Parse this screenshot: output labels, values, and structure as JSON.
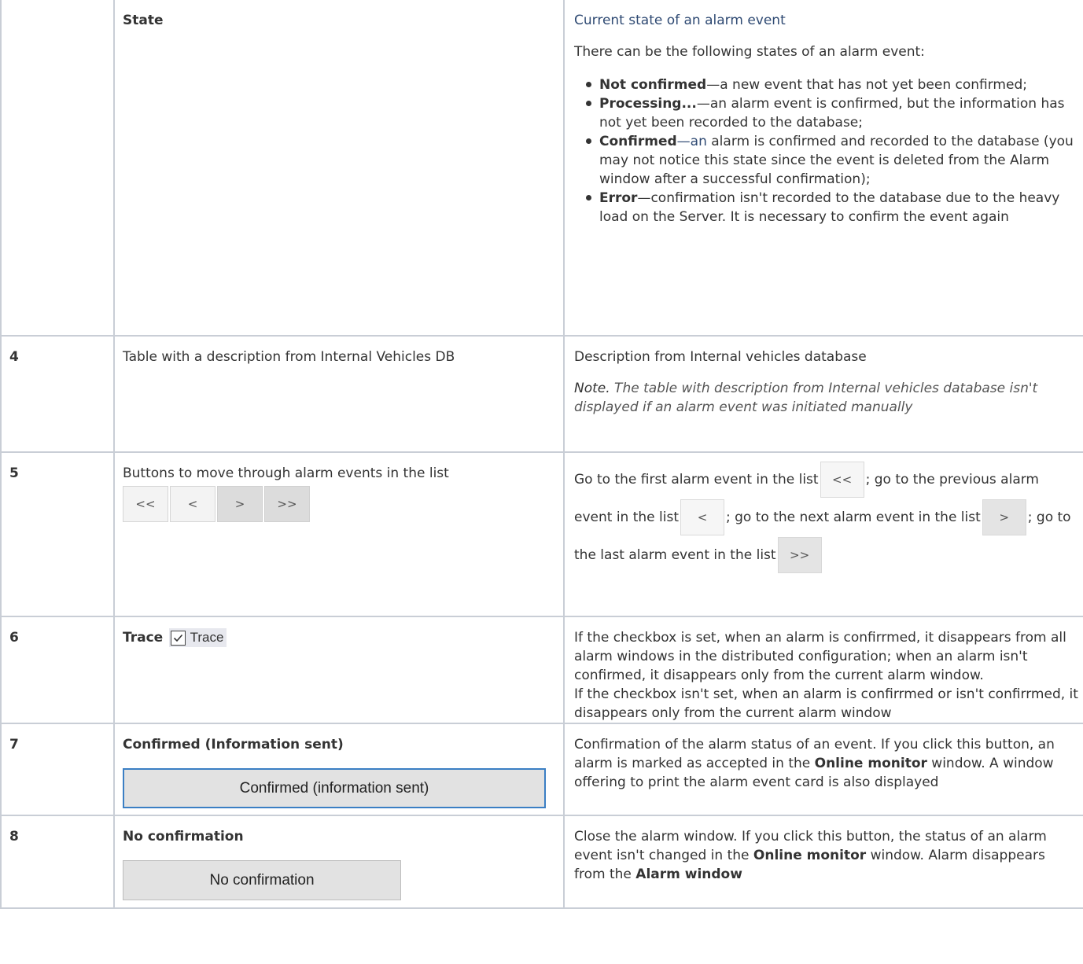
{
  "rows": {
    "state": {
      "num": "",
      "name": "State",
      "desc_title": "Current state of an alarm event",
      "intro": "There can be the following states of an alarm event:",
      "states": [
        {
          "term": "Not confirmed",
          "text": "—a new event that has not yet been confirmed;"
        },
        {
          "term": "Processing...",
          "text": "—an alarm event is confirmed, but the information has not yet been recorded to the database;"
        },
        {
          "term": "Confirmed",
          "text_blue": "—an",
          "text": " alarm is confirmed and recorded to the database (you may not notice this state since the event is deleted from the Alarm window after a successful confirmation);"
        },
        {
          "term": "Error",
          "text": "—confirmation isn't recorded to the database due to the heavy load on the Server. It is necessary to confirm the event again"
        }
      ]
    },
    "r4": {
      "num": "4",
      "name": "Table with a description from Internal Vehicles DB",
      "desc": "Description from Internal vehicles database",
      "note_label": "Note.",
      "note": " The table with description from Internal vehicles database isn't displayed if an alarm event was initiated manually"
    },
    "r5": {
      "num": "5",
      "name": "Buttons to move through alarm events in the list",
      "buttons": [
        "<<",
        "<",
        ">",
        ">>"
      ],
      "d1": "Go to the first alarm event in the list",
      "d2": "; go to the previous alarm event in the list",
      "d3": "; go to the next alarm event in the list",
      "d4": "; go to the last alarm event in the list"
    },
    "r6": {
      "num": "6",
      "name": "Trace",
      "checkbox_label": "Trace",
      "desc1": "If the checkbox is set, when an alarm is confirrmed, it disappears from all alarm windows in the distributed configuration; when an alarm isn't confirmed, it disappears only from the current alarm window.",
      "desc2": "If the checkbox isn't set, when an alarm is confirrmed or isn't confirrmed, it disappears only from the current alarm window"
    },
    "r7": {
      "num": "7",
      "name": "Confirmed (Information sent)",
      "button": "Confirmed (information sent)",
      "d1": "Confirmation of the alarm status of an event. If you click this button, an alarm is marked as accepted in the ",
      "d_bold": "Online monitor",
      "d2": " window. A window offering to print the alarm event card is also displayed"
    },
    "r8": {
      "num": "8",
      "name": "No confirmation",
      "button": "No confirmation",
      "d1": "Close the alarm window. If you click this button, the status of an alarm event isn't changed in the ",
      "d_bold": "Online monitor",
      "d2": " window. Alarm disappears from the ",
      "d_bold2": "Alarm window"
    }
  }
}
